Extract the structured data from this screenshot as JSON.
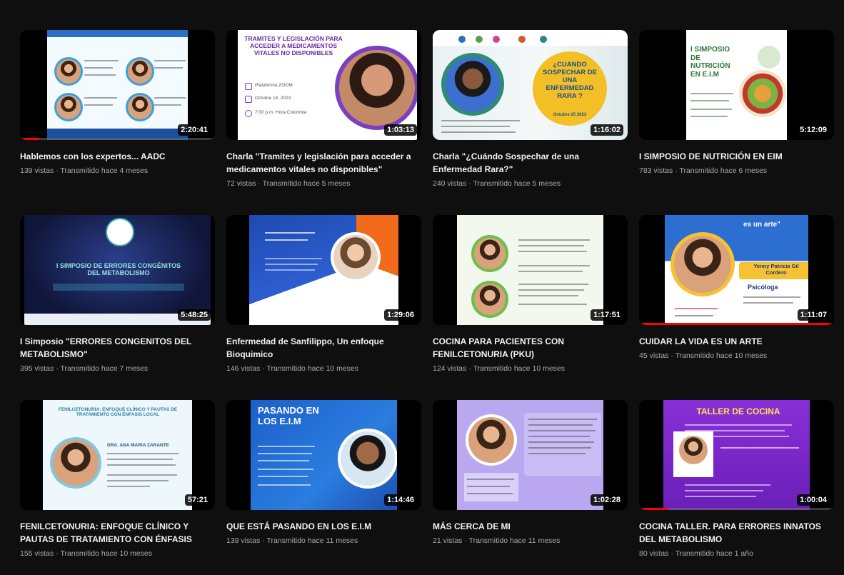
{
  "videos": [
    {
      "title": "Hablemos con los expertos... AADC",
      "views": "139 vistas",
      "age": "Transmitido hace 4 meses",
      "duration": "2:20:41",
      "progress": 0.1,
      "poster": {}
    },
    {
      "title": "Charla \"Tramites y legislación para acceder a medicamentos vitales no disponibles\"",
      "views": "72 vistas",
      "age": "Transmitido hace 5 meses",
      "duration": "1:03:13",
      "progress": 0,
      "poster": {
        "headline": "TRAMITES Y LEGISLACIÓN PARA ACCEDER A MEDICAMENTOS VITALES NO DISPONIBLES",
        "platform": "Plataforma ZOOM",
        "date": "Octubre 18, 2023",
        "time": "7:00 p.m. Hora Colombia"
      }
    },
    {
      "title": "Charla \"¿Cuándo Sospechar de una Enfermedad Rara?\"",
      "views": "240 vistas",
      "age": "Transmitido hace 5 meses",
      "duration": "1:16:02",
      "progress": 0,
      "poster": {
        "headline": "¿CUANDO SOSPECHAR DE UNA ENFERMEDAD RARA ?",
        "date": "Octubre 25 2023"
      }
    },
    {
      "title": "I SIMPOSIO DE NUTRICIÓN EN EIM",
      "views": "783 vistas",
      "age": "Transmitido hace 6 meses",
      "duration": "5:12:09",
      "progress": 0,
      "poster": {
        "headline": "I SIMPOSIO DE NUTRICIÓN EN E.I.M"
      }
    },
    {
      "title": "I Simposio \"ERRORES CONGENITOS DEL METABOLISMO\"",
      "views": "395 vistas",
      "age": "Transmitido hace 7 meses",
      "duration": "5:48:25",
      "progress": 0,
      "poster": {
        "headline": "I SIMPOSIO DE ERRORES CONGÉNITOS DEL METABOLISMO"
      }
    },
    {
      "title": "Enfermedad de Sanfilippo, Un enfoque Bioquimico",
      "views": "146 vistas",
      "age": "Transmitido hace 10 meses",
      "duration": "1:29:06",
      "progress": 0,
      "poster": {}
    },
    {
      "title": "COCINA PARA PACIENTES CON FENILCETONURIA (PKU)",
      "views": "124 vistas",
      "age": "Transmitido hace 10 meses",
      "duration": "1:17:51",
      "progress": 0,
      "poster": {}
    },
    {
      "title": "CUIDAR LA VIDA ES UN ARTE",
      "views": "45 vistas",
      "age": "Transmitido hace 10 meses",
      "duration": "1:11:07",
      "progress": 1.0,
      "poster": {
        "tagline": "es un arte\"",
        "name": "Yenny Patricia Gil Cordero",
        "role": "Psicóloga"
      }
    },
    {
      "title": "FENILCETONURIA: ENFOQUE CLÍNICO Y PAUTAS DE TRATAMIENTO CON ÉNFASIS LOCAL",
      "views": "155 vistas",
      "age": "Transmitido hace 10 meses",
      "duration": "57:21",
      "progress": 0,
      "poster": {
        "headline": "FENILCETONURIA: ENFOQUE CLÍNICO Y PAUTAS DE TRATAMIENTO CON ÉNFASIS LOCAL",
        "speaker": "DRA. ANA MARIA ZARANTE"
      }
    },
    {
      "title": "QUE ESTÁ PASANDO EN LOS E.I.M",
      "views": "139 vistas",
      "age": "Transmitido hace 11 meses",
      "duration": "1:14:46",
      "progress": 0,
      "poster": {
        "headline": "PASANDO EN LOS E.I.M"
      }
    },
    {
      "title": "MÁS CERCA DE MI",
      "views": "21 vistas",
      "age": "Transmitido hace 11 meses",
      "duration": "1:02:28",
      "progress": 0,
      "poster": {}
    },
    {
      "title": "COCINA TALLER. PARA ERRORES INNATOS DEL METABOLISMO",
      "views": "80 vistas",
      "age": "Transmitido hace 1 año",
      "duration": "1:00:04",
      "progress": 0.15,
      "poster": {
        "headline": "TALLER DE COCINA"
      }
    }
  ]
}
